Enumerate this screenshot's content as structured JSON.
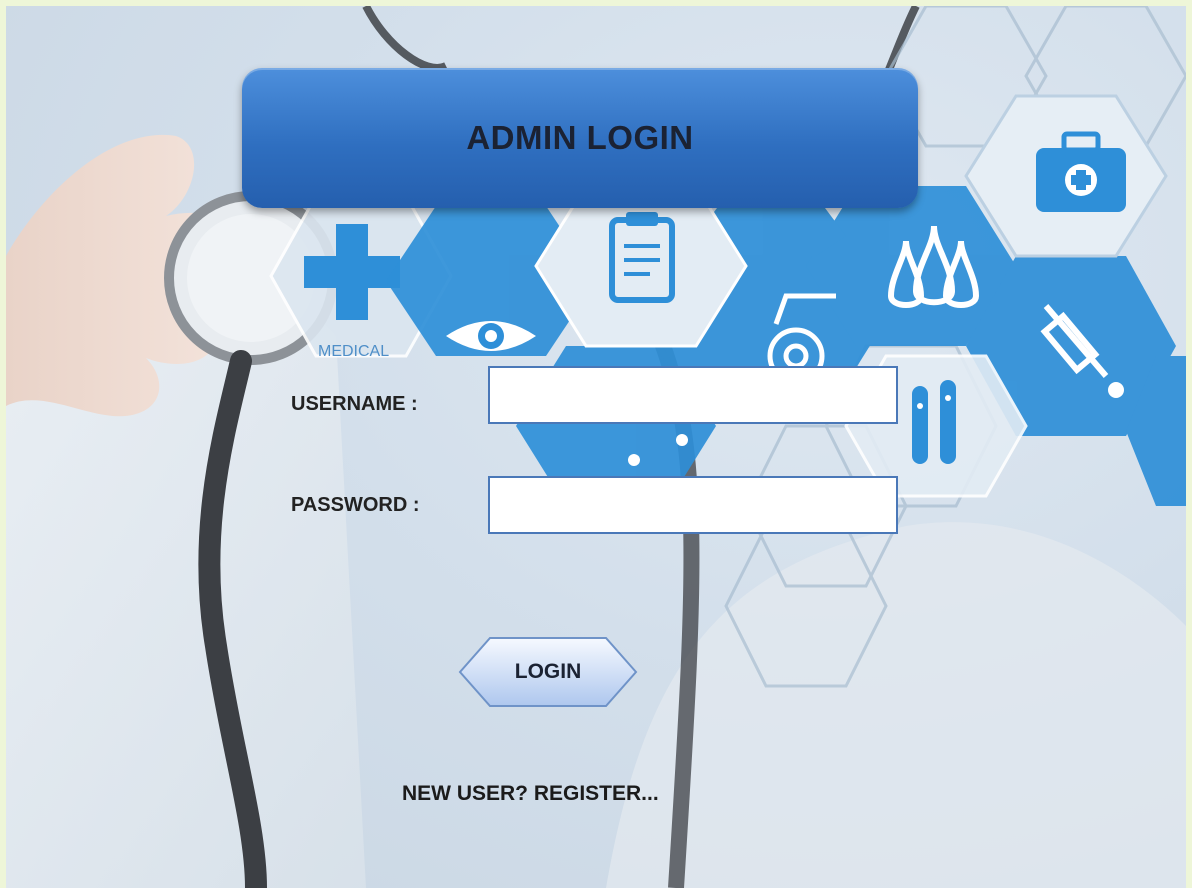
{
  "window": {
    "title": "ADMIN LOGIN"
  },
  "form": {
    "username_label": "USERNAME :",
    "username_value": "",
    "password_label": "PASSWORD :",
    "password_value": "",
    "login_label": "LOGIN",
    "register_label": "NEW USER? REGISTER..."
  },
  "background": {
    "emblem_text": "MEDICAL",
    "icons": [
      "medical-cross-icon",
      "eye-icon",
      "clipboard-icon",
      "wheelchair-icon",
      "water-drops-icon",
      "first-aid-kit-icon",
      "syringe-icon",
      "test-tubes-icon",
      "stethoscope-icon"
    ]
  },
  "colors": {
    "title_box": "#2f6fc0",
    "hex_icon_blue": "#2e8fd8",
    "field_border": "#4a78b8",
    "page_border": "#eef6d8"
  }
}
